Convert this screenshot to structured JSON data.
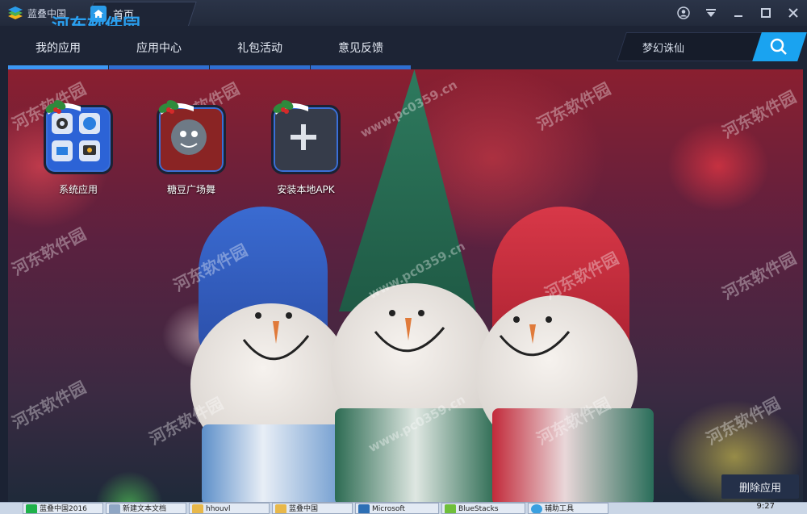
{
  "window": {
    "app_name": "蓝叠中国",
    "home_tab_label": "首页"
  },
  "nav": {
    "tabs": [
      {
        "label": "我的应用",
        "active": true
      },
      {
        "label": "应用中心",
        "active": false
      },
      {
        "label": "礼包活动",
        "active": false
      },
      {
        "label": "意见反馈",
        "active": false
      }
    ]
  },
  "search": {
    "value": "梦幻诛仙"
  },
  "apps": [
    {
      "label": "系统应用",
      "icon": "system-apps-icon"
    },
    {
      "label": "糖豆广场舞",
      "icon": "tangdou-icon"
    },
    {
      "label": "安装本地APK",
      "icon": "plus-icon"
    }
  ],
  "delete_button": {
    "label": "删除应用"
  },
  "watermark": {
    "name": "河东软件园",
    "url": "www.pc0359.cn"
  },
  "taskbar": {
    "items": [
      "蓝叠中国2016",
      "新建文本文档",
      "hhouvl",
      "蓝叠中国",
      "Microsoft",
      "BlueStacks",
      "辅助工具"
    ],
    "clock": "9:27"
  },
  "colors": {
    "accent": "#3c97f3",
    "search_button": "#1aa3f0",
    "titlebar": "#222a3b"
  }
}
